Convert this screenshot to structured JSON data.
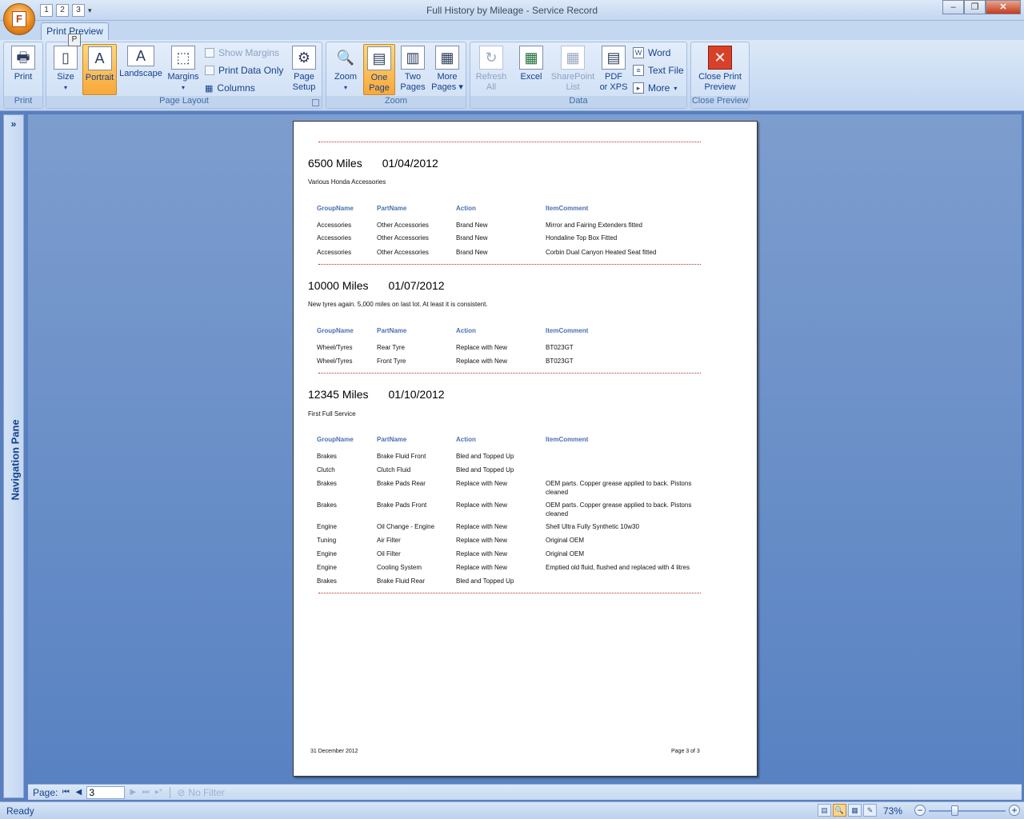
{
  "window": {
    "title": "Full History by Mileage - Service Record"
  },
  "qat": {
    "keys": [
      "1",
      "2",
      "3"
    ]
  },
  "ribbon": {
    "tab": "Print Preview",
    "keytip": "P",
    "groups": {
      "print": "Print",
      "page_layout": "Page Layout",
      "zoom": "Zoom",
      "data": "Data",
      "close_preview": "Close Preview"
    },
    "print_btn": "Print",
    "size_btn": "Size",
    "portrait_btn": "Portrait",
    "landscape_btn": "Landscape",
    "margins_btn": "Margins",
    "show_margins": "Show Margins",
    "print_data_only": "Print Data Only",
    "columns": "Columns",
    "page_setup_1": "Page",
    "page_setup_2": "Setup",
    "zoom_btn": "Zoom",
    "one_page_1": "One",
    "one_page_2": "Page",
    "two_pages_1": "Two",
    "two_pages_2": "Pages",
    "more_pages_1": "More",
    "more_pages_2": "Pages",
    "refresh_1": "Refresh",
    "refresh_2": "All",
    "excel": "Excel",
    "sharepoint_1": "SharePoint",
    "sharepoint_2": "List",
    "pdf_1": "PDF",
    "pdf_2": "or XPS",
    "word": "Word",
    "text_file": "Text File",
    "more": "More",
    "close_1": "Close Print",
    "close_2": "Preview"
  },
  "nav_pane": {
    "label": "Navigation Pane"
  },
  "report": {
    "headers": [
      "GroupName",
      "PartName",
      "Action",
      "ItemComment"
    ],
    "sections": [
      {
        "miles": "6500 Miles",
        "date": "01/04/2012",
        "desc": "Various Honda Accessories",
        "rows": [
          [
            "Accessories",
            "Other Accessories",
            "Brand New",
            "Mirror and Fairing Extenders fitted"
          ],
          [
            "Accessories",
            "Other Accessories",
            "Brand New",
            "Hondaline Top Box Fitted"
          ],
          [
            "Accessories",
            "Other Accessories",
            "Brand New",
            "Corbin Dual Canyon Heated Seat fitted"
          ]
        ]
      },
      {
        "miles": "10000 Miles",
        "date": "01/07/2012",
        "desc": "New tyres again.  5,000 miles on last lot.  At least it is consistent.",
        "rows": [
          [
            "Wheel/Tyres",
            "Rear Tyre",
            "Replace with New",
            "BT023GT"
          ],
          [
            "Wheel/Tyres",
            "Front Tyre",
            "Replace with New",
            "BT023GT"
          ]
        ]
      },
      {
        "miles": "12345 Miles",
        "date": "01/10/2012",
        "desc": "First Full Service",
        "rows": [
          [
            "Brakes",
            "Brake Fluid Front",
            "Bled and Topped Up",
            ""
          ],
          [
            "Clutch",
            "Clutch Fluid",
            "Bled and Topped Up",
            ""
          ],
          [
            "Brakes",
            "Brake Pads Rear",
            "Replace with New",
            "OEM parts. Copper grease applied to back.  Pistons cleaned"
          ],
          [
            "Brakes",
            "Brake Pads Front",
            "Replace with New",
            "OEM parts.  Copper grease applied to back.  Pistons cleaned"
          ],
          [
            "Engine",
            "Oil Change - Engine",
            "Replace with New",
            "Shell Ultra Fully Synthetic 10w30"
          ],
          [
            "Tuning",
            "Air Filter",
            "Replace with New",
            "Original OEM"
          ],
          [
            "Engine",
            "Oil Filter",
            "Replace with New",
            "Original OEM"
          ],
          [
            "Engine",
            "Cooling System",
            "Replace with New",
            "Emptied old fluid, flushed and replaced with 4 litres"
          ],
          [
            "Brakes",
            "Brake Fluid Rear",
            "Bled and Topped Up",
            ""
          ]
        ]
      }
    ],
    "footer_date": "31 December 2012",
    "footer_page": "Page 3 of 3"
  },
  "record_nav": {
    "label": "Page:",
    "value": "3",
    "filter": "No Filter"
  },
  "status": {
    "ready": "Ready",
    "zoom": "73%"
  }
}
